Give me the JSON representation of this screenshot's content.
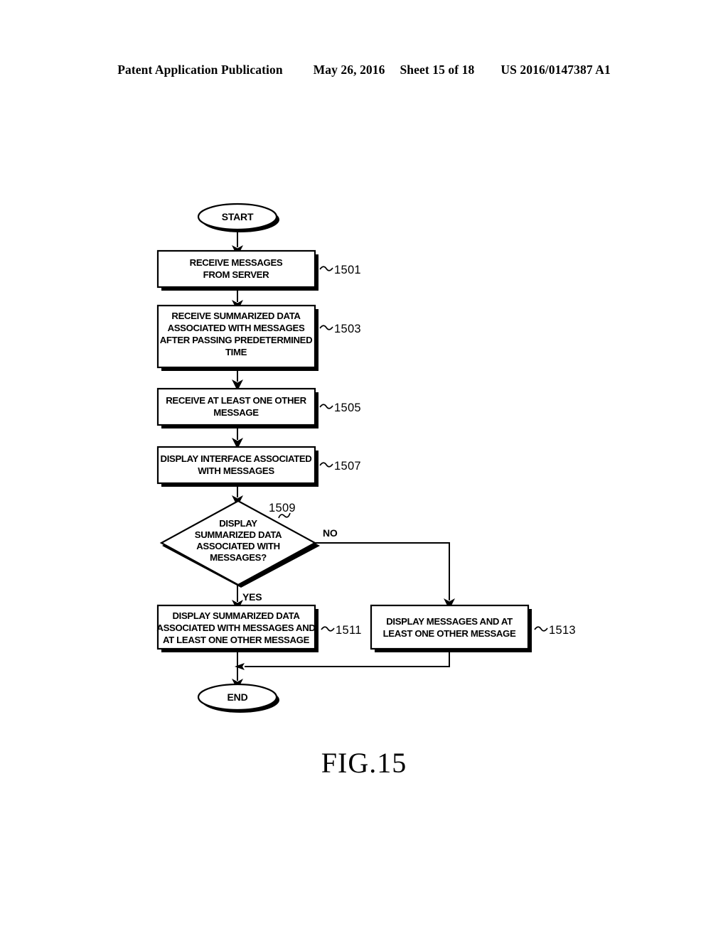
{
  "header": {
    "publication": "Patent Application Publication",
    "date": "May 26, 2016",
    "sheet": "Sheet 15 of 18",
    "patent_number": "US 2016/0147387 A1"
  },
  "figure": {
    "caption": "FIG.15"
  },
  "flowchart": {
    "type": "flowchart",
    "start": {
      "label": "START"
    },
    "end": {
      "label": "END"
    },
    "branch_labels": {
      "yes": "YES",
      "no": "NO"
    },
    "nodes": [
      {
        "id": "1501",
        "shape": "process",
        "ref": "1501",
        "lines": [
          "RECEIVE MESSAGES",
          "FROM SERVER"
        ]
      },
      {
        "id": "1503",
        "shape": "process",
        "ref": "1503",
        "lines": [
          "RECEIVE SUMMARIZED DATA",
          "ASSOCIATED WITH MESSAGES",
          "AFTER PASSING PREDETERMINED",
          "TIME"
        ]
      },
      {
        "id": "1505",
        "shape": "process",
        "ref": "1505",
        "lines": [
          "RECEIVE AT LEAST ONE OTHER",
          "MESSAGE"
        ]
      },
      {
        "id": "1507",
        "shape": "process",
        "ref": "1507",
        "lines": [
          "DISPLAY INTERFACE ASSOCIATED",
          "WITH MESSAGES"
        ]
      },
      {
        "id": "1509",
        "shape": "decision",
        "ref": "1509",
        "lines": [
          "DISPLAY",
          "SUMMARIZED DATA",
          "ASSOCIATED WITH",
          "MESSAGES?"
        ]
      },
      {
        "id": "1511",
        "shape": "process",
        "ref": "1511",
        "lines": [
          "DISPLAY SUMMARIZED DATA",
          "ASSOCIATED WITH MESSAGES AND",
          "AT LEAST ONE OTHER MESSAGE"
        ]
      },
      {
        "id": "1513",
        "shape": "process",
        "ref": "1513",
        "lines": [
          "DISPLAY MESSAGES AND AT",
          "LEAST ONE OTHER MESSAGE"
        ]
      }
    ]
  }
}
